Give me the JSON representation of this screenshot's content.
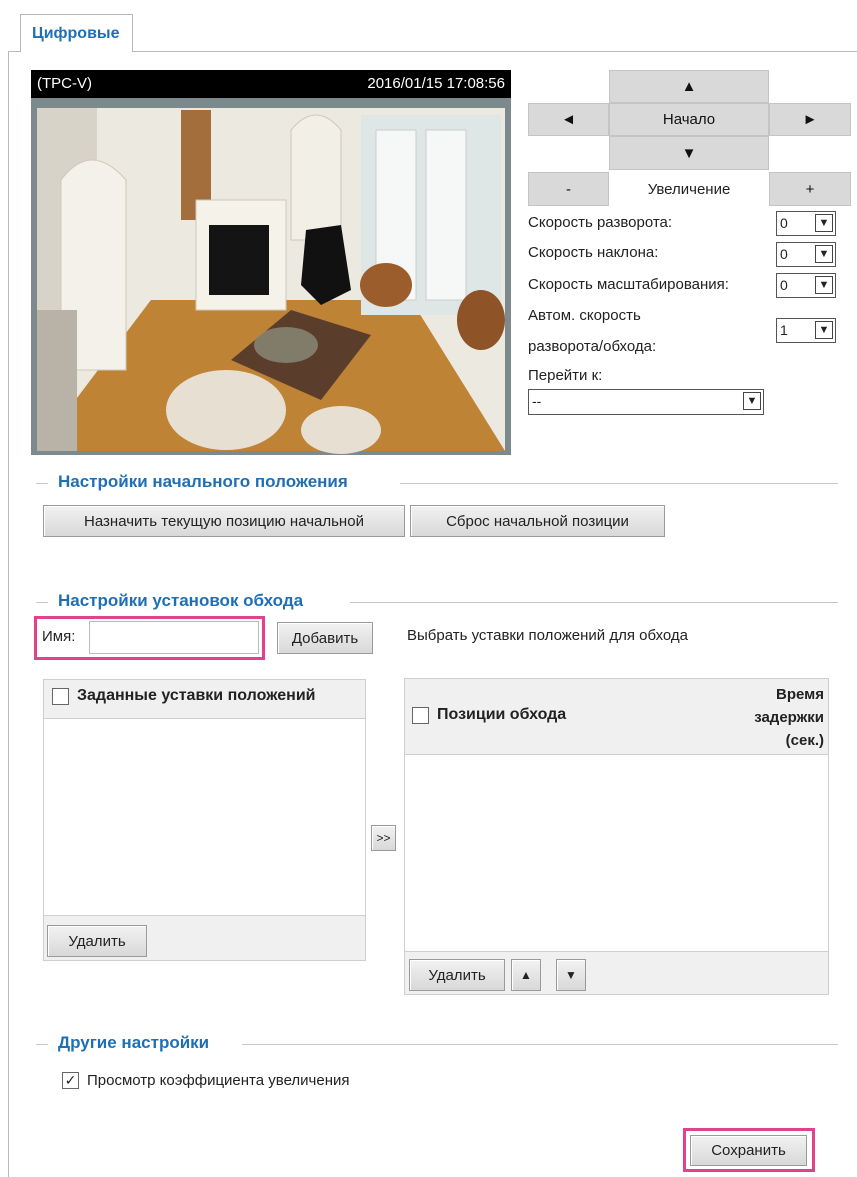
{
  "tab": {
    "label": "Цифровые"
  },
  "camera": {
    "name": "(TPC-V)",
    "datetime": "2016/01/15  17:08:56"
  },
  "ptz": {
    "up": "▲",
    "down": "▼",
    "left": "◄",
    "right": "►",
    "home": "Начало",
    "zoom_out": "-",
    "zoom_label": "Увеличение",
    "zoom_in": "+"
  },
  "speeds": {
    "pan_label": "Скорость разворота:",
    "pan_value": "0",
    "tilt_label": "Скорость наклона:",
    "tilt_value": "0",
    "zoom_label": "Скорость масштабирования:",
    "zoom_value": "0",
    "auto_label_1": "Автом. скорость",
    "auto_label_2": "разворота/обхода:",
    "auto_value": "1",
    "goto_label": "Перейти к:",
    "goto_value": "--"
  },
  "home_settings": {
    "title": "Настройки начального положения",
    "set_button": "Назначить текущую позицию начальной",
    "reset_button": "Сброс начальной позиции"
  },
  "patrol": {
    "title": "Настройки установок обхода",
    "name_label": "Имя:",
    "name_value": "",
    "add_button": "Добавить",
    "hint": "Выбрать уставки положений для обхода",
    "presets_header": "Заданные уставки положений",
    "positions_header": "Позиции обхода",
    "delay_1": "Время",
    "delay_2": "задержки",
    "delay_3": "(сек.)",
    "move_button": ">>",
    "delete_left": "Удалить",
    "delete_right": "Удалить",
    "up": "▲",
    "down": "▼"
  },
  "other": {
    "title": "Другие настройки",
    "zoom_ratio_label": "Просмотр коэффициента увеличения",
    "zoom_ratio_checked": true
  },
  "save_button": "Сохранить"
}
